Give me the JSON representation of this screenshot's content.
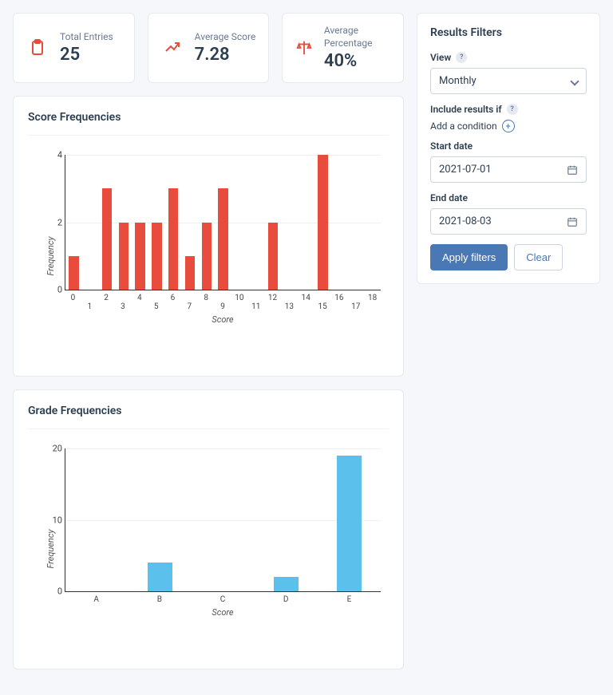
{
  "stats": {
    "total_entries": {
      "label": "Total Entries",
      "value": "25"
    },
    "avg_score": {
      "label": "Average Score",
      "value": "7.28"
    },
    "avg_pct": {
      "label": "Average Percentage",
      "value": "40%"
    }
  },
  "score_chart_title": "Score Frequencies",
  "grade_chart_title": "Grade Frequencies",
  "axes": {
    "score_y_label": "Frequency",
    "score_x_label": "Score",
    "grade_y_label": "Frequency",
    "grade_x_label": "Score"
  },
  "filters": {
    "title": "Results Filters",
    "view_label": "View",
    "view_value": "Monthly",
    "include_label": "Include results if",
    "add_condition": "Add a condition",
    "start_label": "Start date",
    "start_value": "2021-07-01",
    "end_label": "End date",
    "end_value": "2021-08-03",
    "apply": "Apply filters",
    "clear": "Clear"
  },
  "chart_data": [
    {
      "type": "bar",
      "title": "Score Frequencies",
      "xlabel": "Score",
      "ylabel": "Frequency",
      "ylim": [
        0,
        4
      ],
      "categories": [
        0,
        1,
        2,
        3,
        4,
        5,
        6,
        7,
        8,
        9,
        10,
        11,
        12,
        13,
        14,
        15,
        16,
        17,
        18
      ],
      "values": [
        1,
        0,
        3,
        2,
        2,
        2,
        3,
        1,
        2,
        3,
        0,
        0,
        2,
        0,
        0,
        4,
        0,
        0,
        0
      ]
    },
    {
      "type": "bar",
      "title": "Grade Frequencies",
      "xlabel": "Score",
      "ylabel": "Frequency",
      "ylim": [
        0,
        20
      ],
      "categories": [
        "A",
        "B",
        "C",
        "D",
        "E"
      ],
      "values": [
        0,
        4,
        0,
        2,
        19
      ]
    }
  ]
}
